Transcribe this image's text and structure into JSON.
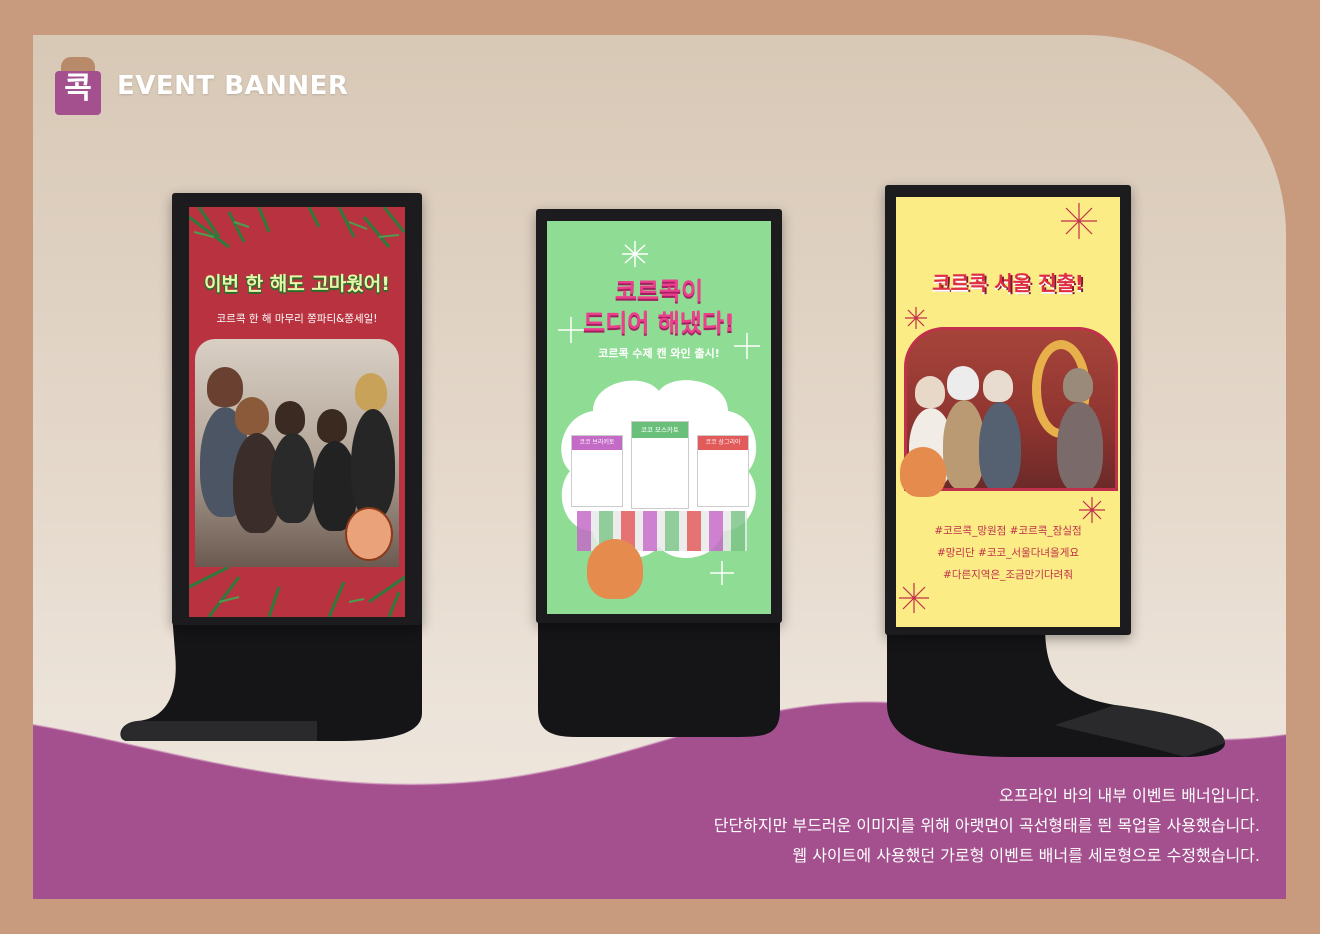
{
  "brand": {
    "logo_glyph": "콕",
    "title": "EVENT BANNER"
  },
  "banners": [
    {
      "headline": "이번 한 해도 고마웠어!",
      "subtitle": "코르콕 한 해 마무리 쫑파티&쫑세일!",
      "bg_color": "#b8333f"
    },
    {
      "headline_line1": "코르콕이",
      "headline_line2": "드디어 해냈다!",
      "subtitle": "코르콕 수제 캔 와인 출시!",
      "bg_color": "#8fdc94",
      "products": [
        "코코 브라키토",
        "코코 모스카토",
        "코코 상그리아"
      ]
    },
    {
      "headline": "코르콕 서울 진출!",
      "bg_color": "#fbec86",
      "tags": [
        "#코르콕_망원점  #코르콕_잠실점",
        "#망리단 #코코_서울다녀올게요",
        "#다른지역은_조금만기다려줘"
      ]
    }
  ],
  "description": [
    "오프라인 바의 내부 이벤트 배너입니다.",
    "단단하지만 부드러운 이미지를 위해 아랫면이 곡선형태를 띈 목업을 사용했습니다.",
    "웹 사이트에 사용했던 가로형 이벤트 배너를 세로형으로 수정했습니다."
  ],
  "colors": {
    "outer": "#c89a7e",
    "accent": "#a4508f",
    "stand": "#1c1c1e"
  }
}
